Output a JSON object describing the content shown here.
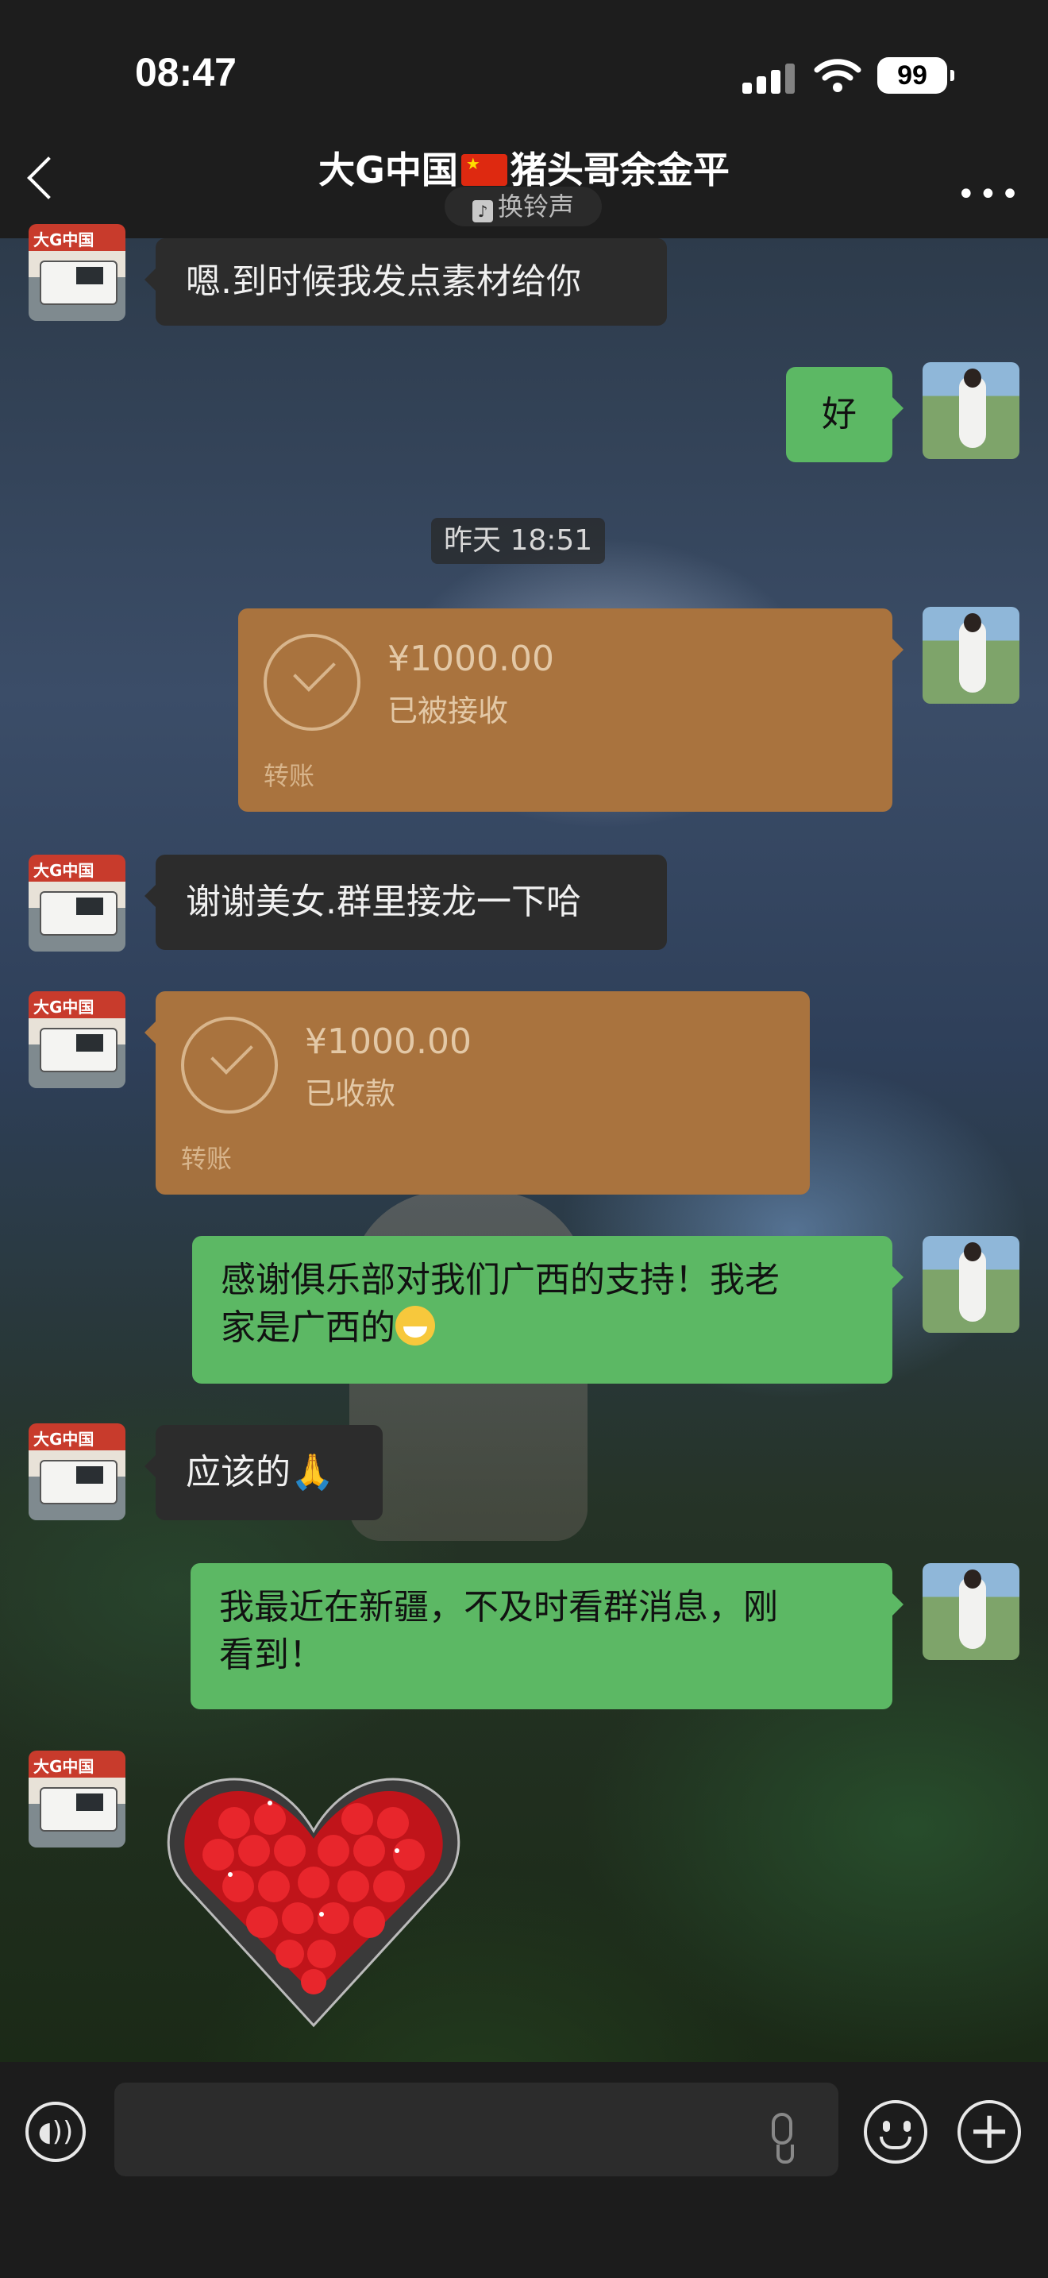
{
  "status_bar": {
    "time": "08:47",
    "battery": "99"
  },
  "header": {
    "title_before_flag": "大G中国",
    "title_after_flag": "猪头哥余金平",
    "ringtone_label": "换铃声",
    "more": "•••"
  },
  "timestamp": "昨天 18:51",
  "messages": [
    {
      "id": "m1",
      "from": "other",
      "type": "text",
      "text": "嗯.到时候我发点素材给你"
    },
    {
      "id": "m2",
      "from": "me",
      "type": "text",
      "text": "好"
    },
    {
      "id": "m3",
      "from": "me",
      "type": "transfer",
      "amount": "¥1000.00",
      "status": "已被接收",
      "label": "转账"
    },
    {
      "id": "m4",
      "from": "other",
      "type": "text",
      "text": "谢谢美女.群里接龙一下哈"
    },
    {
      "id": "m5",
      "from": "other",
      "type": "transfer",
      "amount": "¥1000.00",
      "status": "已收款",
      "label": "转账"
    },
    {
      "id": "m6",
      "from": "me",
      "type": "text",
      "line1": "感谢俱乐部对我们广西的支持！我老",
      "line2": "家是广西的",
      "emoji": "grin-emoji"
    },
    {
      "id": "m7",
      "from": "other",
      "type": "text",
      "text": "应该的",
      "emoji": "pray-emoji"
    },
    {
      "id": "m8",
      "from": "me",
      "type": "text",
      "line1": "我最近在新疆，不及时看群消息，刚",
      "line2": "看到！"
    },
    {
      "id": "m9",
      "from": "other",
      "type": "sticker",
      "sticker": "rose-heart-sticker"
    }
  ],
  "avatars": {
    "other_sign": "大G中国"
  },
  "input_bar": {
    "voice_icon": "voice-icon",
    "mic_icon": "mic-icon",
    "emoji_icon": "emoji-icon",
    "plus_icon": "plus-icon"
  },
  "colors": {
    "bubble_green": "#5cb864",
    "bubble_dark": "#2c2c2c",
    "transfer": "#a9733e",
    "header_bg": "#1d1d1d"
  }
}
